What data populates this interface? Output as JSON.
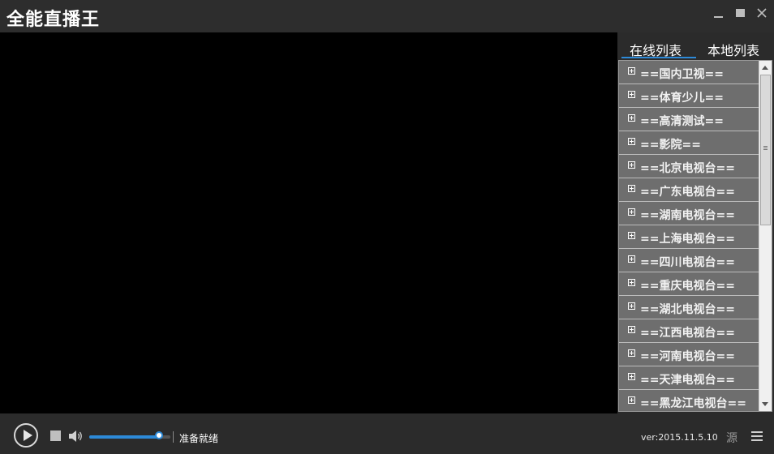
{
  "app": {
    "title": "全能直播王"
  },
  "window_controls": [
    "minimize-icon",
    "maximize-icon",
    "close-icon"
  ],
  "playlist": {
    "tabs": [
      {
        "label": "在线列表",
        "active": true
      },
      {
        "label": "本地列表",
        "active": false
      }
    ],
    "items": [
      {
        "label": "==国内卫视=="
      },
      {
        "label": "==体育少儿=="
      },
      {
        "label": "==高清测试=="
      },
      {
        "label": "==影院=="
      },
      {
        "label": "==北京电视台=="
      },
      {
        "label": "==广东电视台=="
      },
      {
        "label": "==湖南电视台=="
      },
      {
        "label": "==上海电视台=="
      },
      {
        "label": "==四川电视台=="
      },
      {
        "label": "==重庆电视台=="
      },
      {
        "label": "==湖北电视台=="
      },
      {
        "label": "==江西电视台=="
      },
      {
        "label": "==河南电视台=="
      },
      {
        "label": "==天津电视台=="
      },
      {
        "label": "==黑龙江电视台=="
      }
    ]
  },
  "controls": {
    "volume_level": 0.86,
    "status": "准备就绪",
    "version": "ver:2015.11.5.10",
    "source_label": "源"
  },
  "colors": {
    "accent": "#2d8ad8",
    "background": "#2b2b2b",
    "video": "#000000",
    "list_item": "#6e6e6e"
  }
}
